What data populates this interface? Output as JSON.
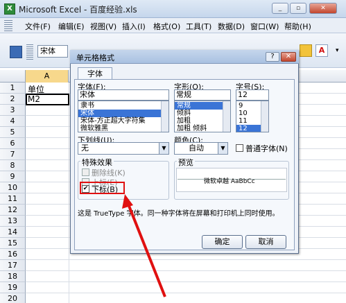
{
  "window": {
    "title": "Microsoft Excel - 百度经验.xls",
    "min_glyph": "_",
    "restore_glyph": "▫",
    "close_glyph": "✕"
  },
  "menu": {
    "items": [
      "文件(F)",
      "编辑(E)",
      "视图(V)",
      "插入(I)",
      "格式(O)",
      "工具(T)",
      "数据(D)",
      "窗口(W)",
      "帮助(H)"
    ]
  },
  "toolbar": {
    "font_name": "宋体"
  },
  "sheet": {
    "column_header": "A",
    "rows": [
      "1",
      "2",
      "3",
      "4",
      "5",
      "6",
      "7",
      "8",
      "9",
      "10",
      "11",
      "12",
      "13",
      "14",
      "15",
      "16",
      "17",
      "18",
      "19",
      "20"
    ],
    "cells": {
      "a1": "单位",
      "a2": "M2"
    }
  },
  "dialog": {
    "title": "单元格格式",
    "help_glyph": "?",
    "close_glyph": "✕",
    "tab_font": "字体",
    "font_label": "字体(F):",
    "font_value": "宋体",
    "font_list": [
      "隶书",
      "宋体",
      "宋体-方正超大字符集",
      "微软雅黑"
    ],
    "font_selected_index": 1,
    "style_label": "字形(O):",
    "style_value": "常规",
    "style_list": [
      "常规",
      "倾斜",
      "加粗",
      "加粗 倾斜"
    ],
    "style_selected_index": 0,
    "size_label": "字号(S):",
    "size_value": "12",
    "size_list": [
      "9",
      "10",
      "11",
      "12"
    ],
    "size_selected_index": 3,
    "underline_label": "下划线(U):",
    "underline_value": "无",
    "color_label": "颜色(C):",
    "color_value": "自动",
    "normal_font_label": "普通字体(N)",
    "effects_label": "特殊效果",
    "strikethrough_label": "删除线(K)",
    "superscript_label": "上标(E)",
    "subscript_label": "下标(B)",
    "subscript_checked": true,
    "preview_label": "预览",
    "preview_text": "微软卓越  AaBbCc",
    "info_text": "这是 TrueType 字体。同一种字体将在屏幕和打印机上同时使用。",
    "ok_label": "确定",
    "cancel_label": "取消"
  },
  "annotation": {
    "highlight_color": "#e01010"
  }
}
